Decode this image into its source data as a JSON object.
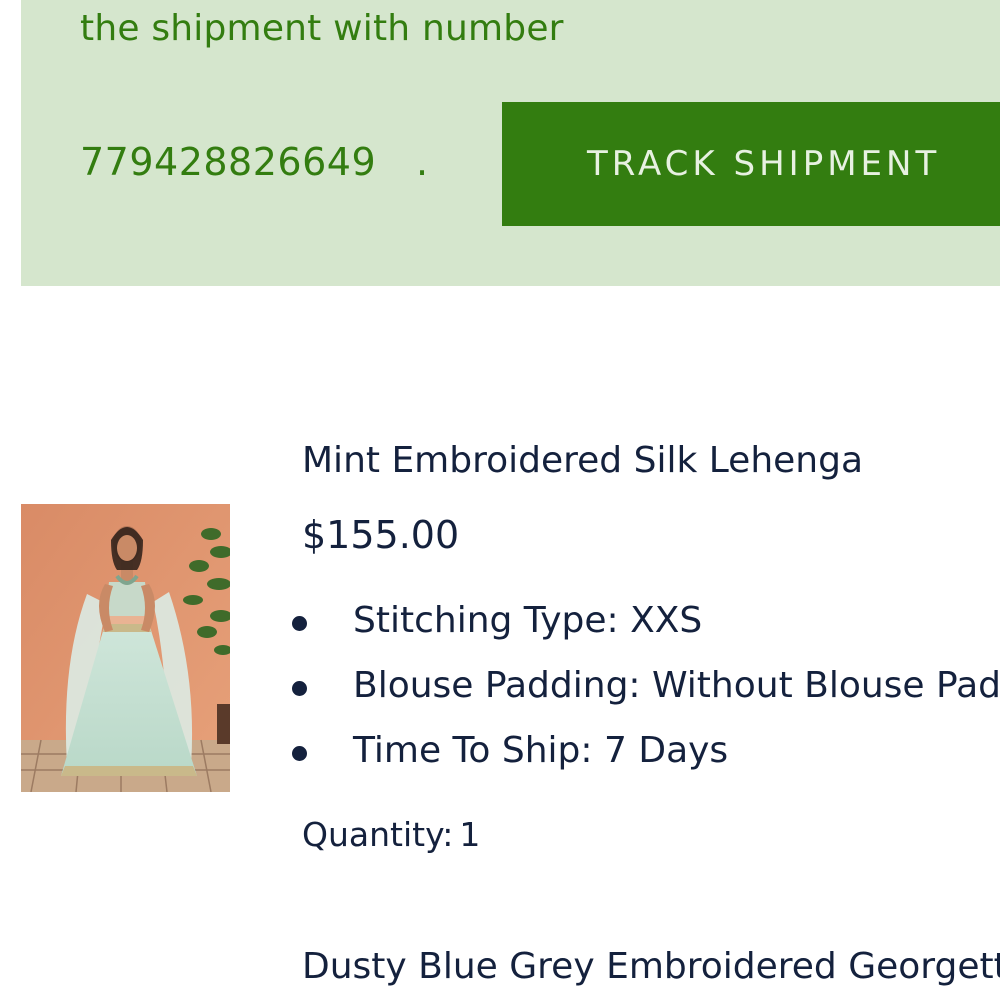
{
  "shipment_banner": {
    "text": "the shipment with number",
    "tracking_number": "779428826649",
    "period": ".",
    "track_button_label": "TRACK SHIPMENT",
    "background_color": "#d5e6cd",
    "accent_color": "#337d10"
  },
  "order_items": [
    {
      "title": "Mint Embroidered Silk Lehenga",
      "price": "$155.00",
      "attributes": [
        {
          "label": "Stitching Type:",
          "value": "XXS"
        },
        {
          "label": "Blouse Padding:",
          "value": "Without Blouse Padding"
        },
        {
          "label": "Time To Ship:",
          "value": "7 Days"
        }
      ],
      "quantity_label": "Quantity:",
      "quantity_value": "1",
      "image": "product-photo"
    },
    {
      "title": "Dusty Blue Grey Embroidered Georgette"
    }
  ],
  "text_color": "#14213d"
}
